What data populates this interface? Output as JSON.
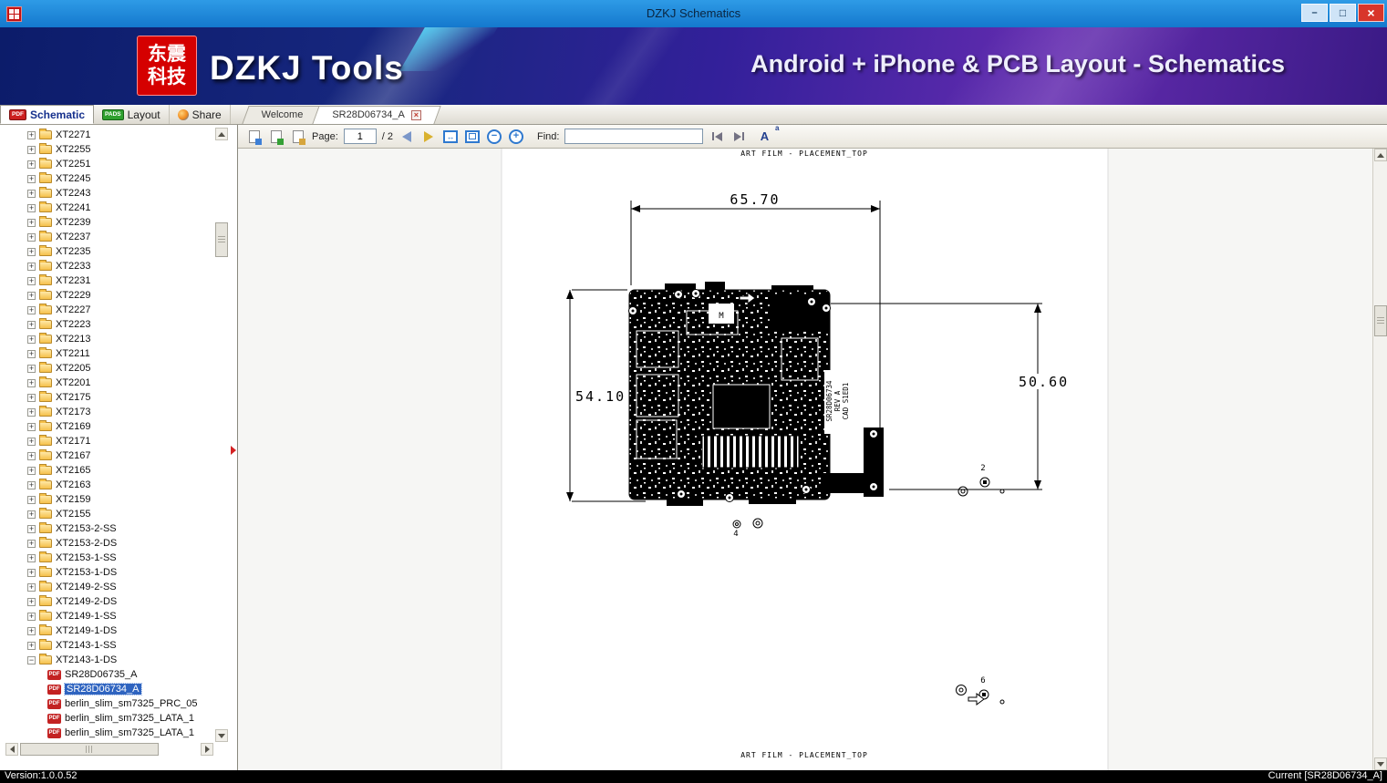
{
  "window": {
    "title": "DZKJ Schematics"
  },
  "colors": {
    "titlebar_blue": "#1478cd",
    "brand_red": "#d50000",
    "close_red": "#d8352a",
    "selection_blue": "#2f64c0"
  },
  "banner": {
    "logo_line1": "东震",
    "logo_line2": "科技",
    "app_name": "DZKJ Tools",
    "tagline": "Android + iPhone & PCB Layout - Schematics"
  },
  "main_tabs": [
    {
      "label": "Schematic",
      "icon": "pdf-icon",
      "active": true
    },
    {
      "label": "Layout",
      "icon": "pads-icon",
      "active": false
    },
    {
      "label": "Share",
      "icon": "share-icon",
      "active": false
    }
  ],
  "doc_tabs": [
    {
      "label": "Welcome",
      "active": false
    },
    {
      "label": "SR28D06734_A",
      "active": true,
      "closable": true
    }
  ],
  "toolbar": {
    "page_label": "Page:",
    "page_value": "1",
    "page_total": "/ 2",
    "find_label": "Find:",
    "find_value": ""
  },
  "sidebar": {
    "folders": [
      {
        "label": "XT2271"
      },
      {
        "label": "XT2255"
      },
      {
        "label": "XT2251"
      },
      {
        "label": "XT2245"
      },
      {
        "label": "XT2243"
      },
      {
        "label": "XT2241"
      },
      {
        "label": "XT2239"
      },
      {
        "label": "XT2237"
      },
      {
        "label": "XT2235"
      },
      {
        "label": "XT2233"
      },
      {
        "label": "XT2231"
      },
      {
        "label": "XT2229"
      },
      {
        "label": "XT2227"
      },
      {
        "label": "XT2223"
      },
      {
        "label": "XT2213"
      },
      {
        "label": "XT2211"
      },
      {
        "label": "XT2205"
      },
      {
        "label": "XT2201"
      },
      {
        "label": "XT2175"
      },
      {
        "label": "XT2173"
      },
      {
        "label": "XT2169"
      },
      {
        "label": "XT2171"
      },
      {
        "label": "XT2167"
      },
      {
        "label": "XT2165"
      },
      {
        "label": "XT2163"
      },
      {
        "label": "XT2159"
      },
      {
        "label": "XT2155"
      },
      {
        "label": "XT2153-2-SS"
      },
      {
        "label": "XT2153-2-DS"
      },
      {
        "label": "XT2153-1-SS"
      },
      {
        "label": "XT2153-1-DS"
      },
      {
        "label": "XT2149-2-SS"
      },
      {
        "label": "XT2149-2-DS"
      },
      {
        "label": "XT2149-1-SS"
      },
      {
        "label": "XT2149-1-DS"
      },
      {
        "label": "XT2143-1-SS"
      },
      {
        "label": "XT2143-1-DS",
        "expanded": true
      }
    ],
    "files": [
      {
        "label": "SR28D06735_A"
      },
      {
        "label": "SR28D06734_A",
        "selected": true
      },
      {
        "label": "berlin_slim_sm7325_PRC_05"
      },
      {
        "label": "berlin_slim_sm7325_LATA_1"
      },
      {
        "label": "berlin_slim_sm7325_LATA_1"
      }
    ]
  },
  "document": {
    "header": "ART FILM - PLACEMENT_TOP",
    "footer": "ART FILM - PLACEMENT_TOP",
    "dim_width": "65.70",
    "dim_left": "54.10",
    "dim_right": "50.60",
    "board_line1": "SR28D06734",
    "board_line2": "REV A",
    "board_line3": "CAD S1ED1",
    "marker_m": "M",
    "marker_2": "2",
    "marker_4": "4",
    "marker_6": "6"
  },
  "statusbar": {
    "version": "Version:1.0.0.52",
    "current": "Current [SR28D06734_A]"
  }
}
